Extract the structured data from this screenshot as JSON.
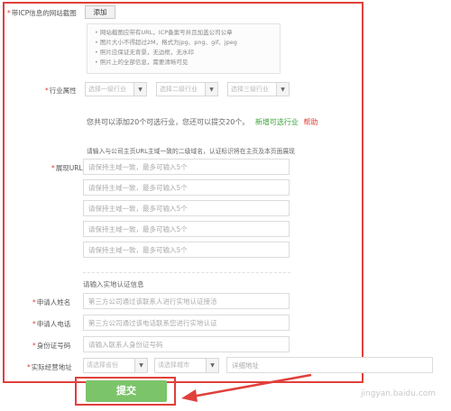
{
  "icp_screenshot": {
    "label": "带ICP信息的网站截图",
    "add_button": "添加",
    "notes": [
      "网站截图应带有URL，ICP备案号并且加盖公司公章",
      "图片大小不得超过2M，格式为jpg、png、gif、jpeg",
      "照片应保证无背景，无边框，无水印",
      "照片上的全部信息，需要清晰可见"
    ]
  },
  "industry": {
    "label": "行业属性",
    "level1_placeholder": "选择一级行业",
    "level2_placeholder": "选择二级行业",
    "level3_placeholder": "选择三级行业"
  },
  "industry_limit": {
    "prefix": "您共可以添加",
    "max": "20",
    "middle": "个可选行业，您还可以提交",
    "remaining": "20",
    "suffix": "个。",
    "add_link": "新增可选行业",
    "help_link": "帮助"
  },
  "url_section": {
    "hint": "请输入与公司主页URL主域一致的二级域名，认证标识将在主页及本页面展现",
    "label": "展现URL",
    "placeholder": "请保持主域一致，最多可输入5个",
    "field_count": 5
  },
  "verify_section": {
    "title": "请输入实地认证信息",
    "name_label": "申请人姓名",
    "name_placeholder": "第三方公司通过该联系人进行实地认证接洽",
    "phone_label": "申请人电话",
    "phone_placeholder": "第三方公司通过该电话联系您进行实地认证",
    "id_label": "身份证号码",
    "id_placeholder": "请输入联系人身份证号码",
    "address_label": "实际经营地址",
    "province_placeholder": "请选择省份",
    "city_placeholder": "请选择城市",
    "address_placeholder": "详细地址"
  },
  "submit_label": "提交",
  "watermark": "jingyan.baidu.com",
  "annotation_color": "#e0403b"
}
